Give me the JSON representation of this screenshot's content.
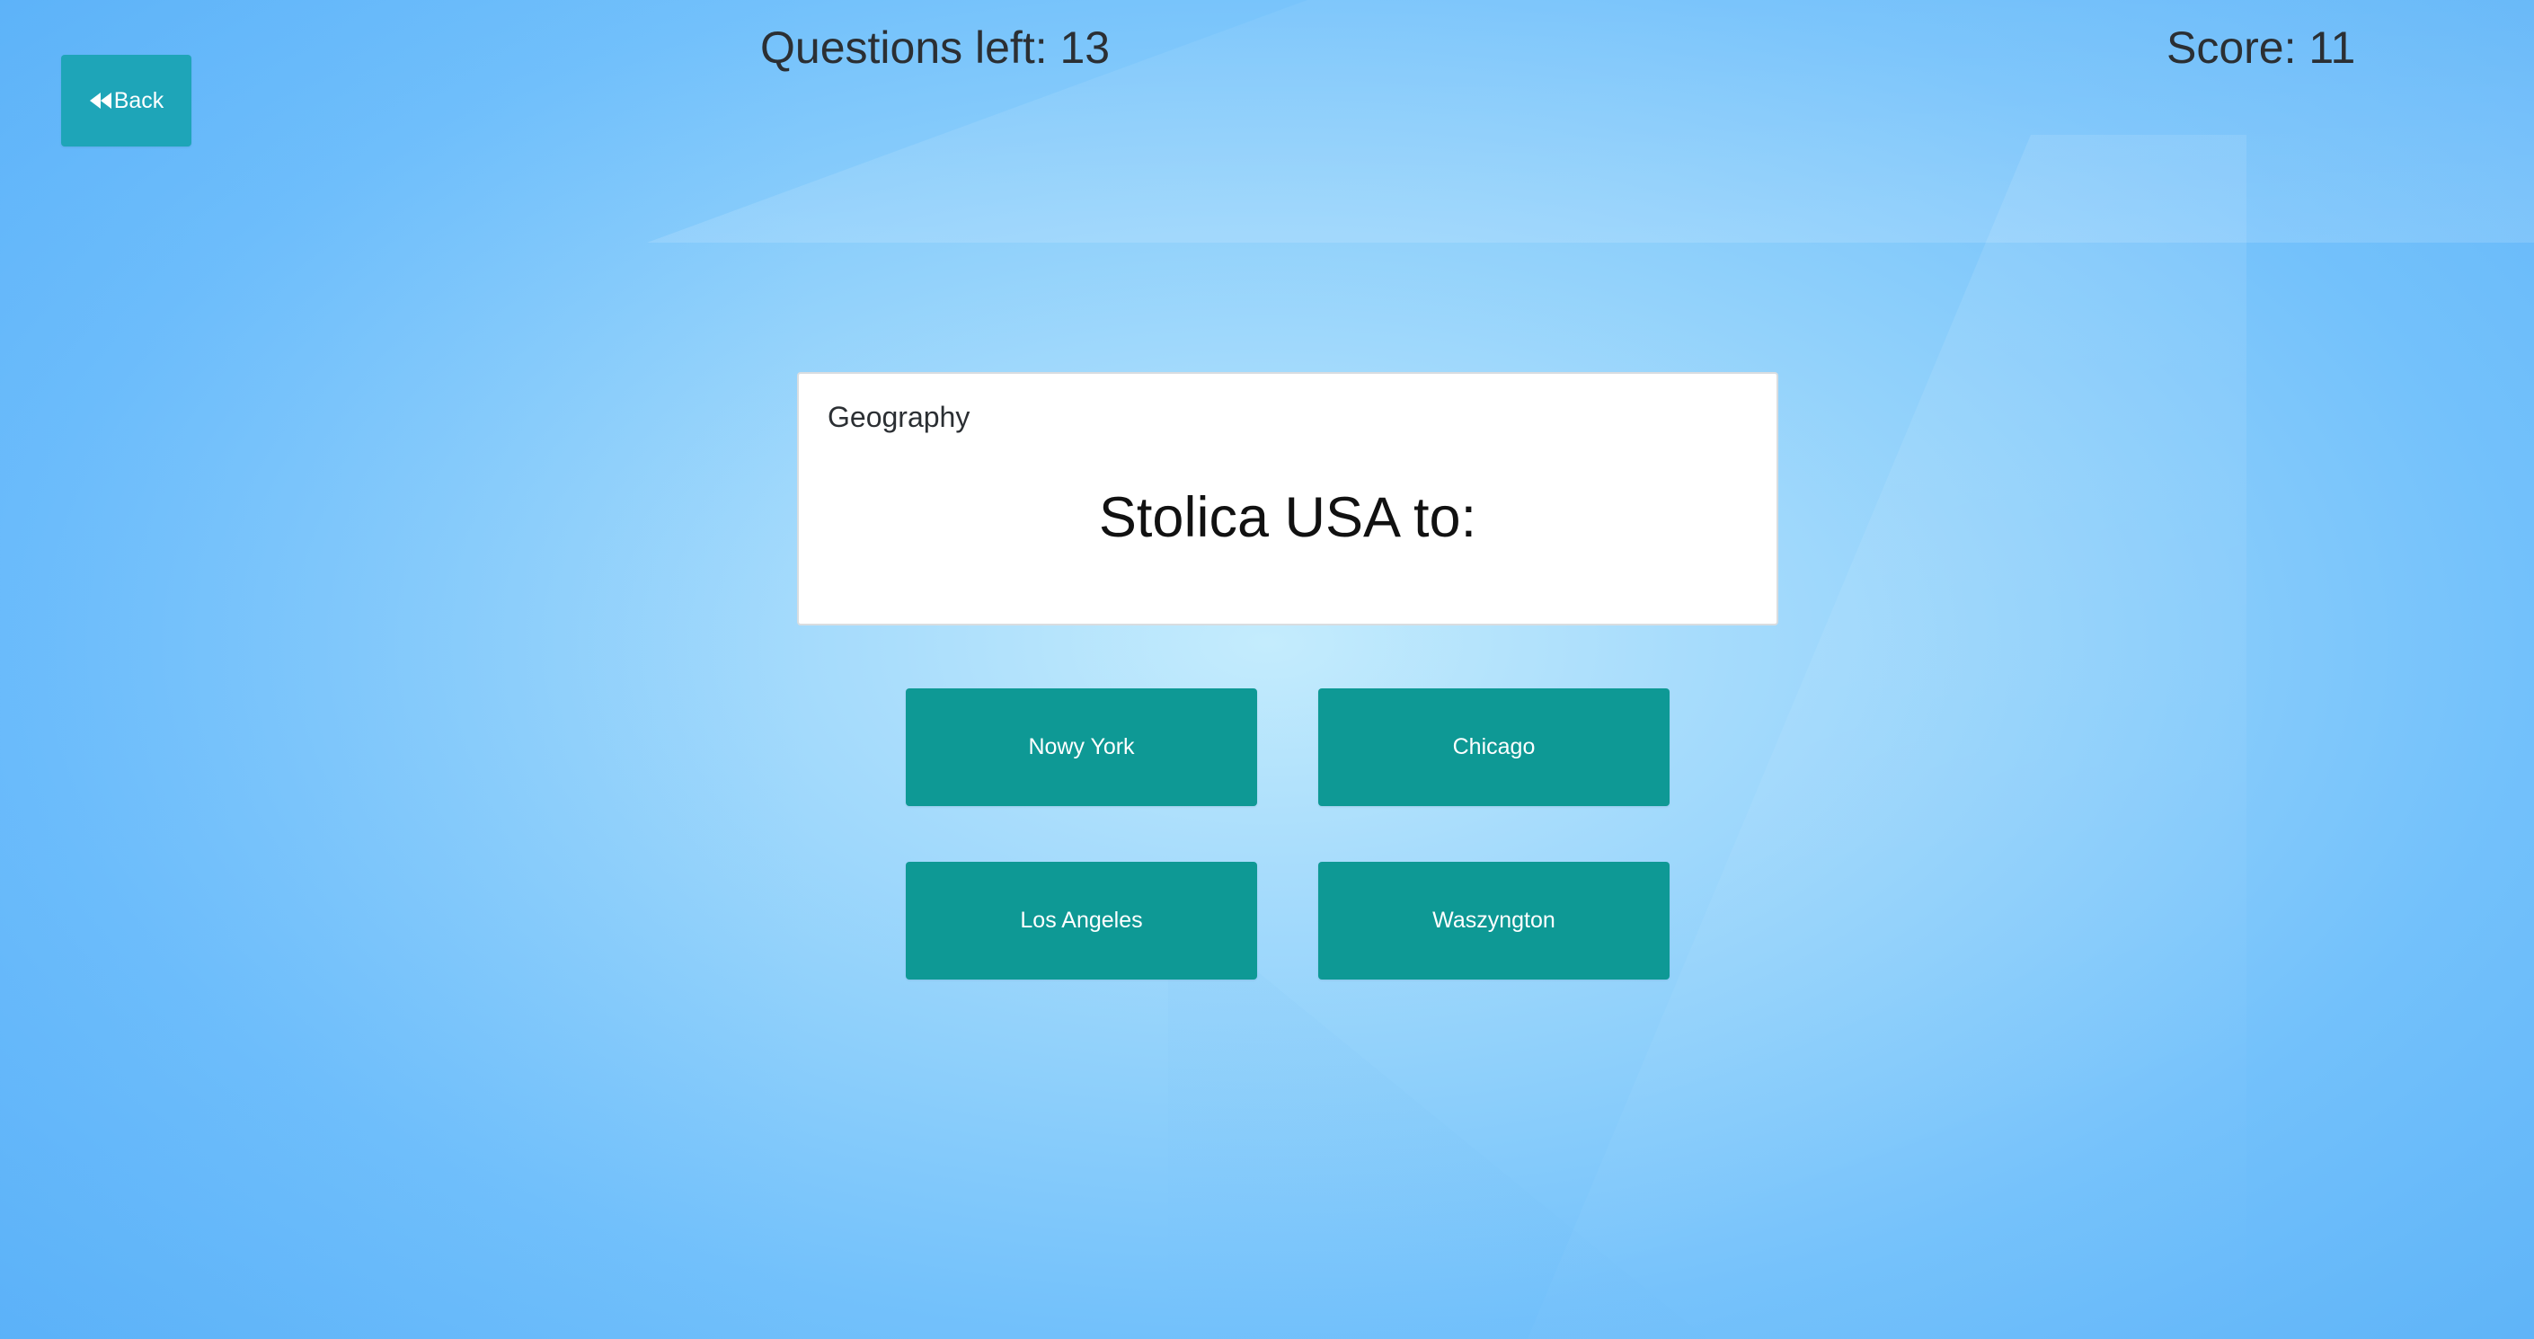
{
  "header": {
    "back_label": "Back",
    "questions_left": "Questions left: 13",
    "score": "Score: 11"
  },
  "question": {
    "category": "Geography",
    "text": "Stolica USA to:"
  },
  "answers": [
    {
      "label": "Nowy York"
    },
    {
      "label": "Chicago"
    },
    {
      "label": "Los Angeles"
    },
    {
      "label": "Waszyngton"
    }
  ],
  "colors": {
    "back_button": "#1ea5b8",
    "answer_button": "#0e9995",
    "background": "#8fd0fb",
    "card": "#ffffff"
  },
  "icons": {
    "back": "fast-backward-icon"
  }
}
